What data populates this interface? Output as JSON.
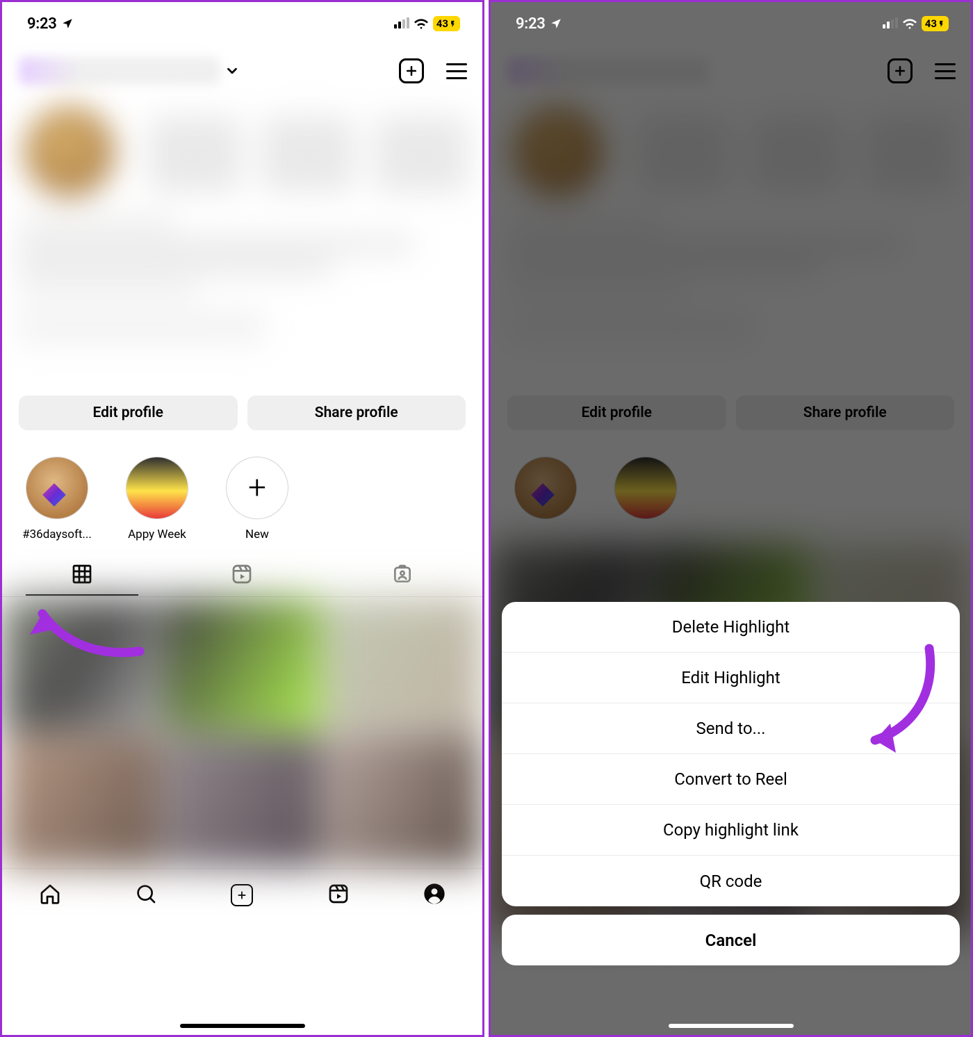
{
  "status": {
    "time": "9:23",
    "battery": "43",
    "battery_charging": true
  },
  "header": {
    "create_label": "Create",
    "menu_label": "Menu"
  },
  "actions": {
    "edit_profile": "Edit profile",
    "share_profile": "Share profile"
  },
  "highlights": [
    {
      "label": "#36daysoft...",
      "kind": "days"
    },
    {
      "label": "Appy Week",
      "kind": "appy"
    },
    {
      "label": "New",
      "kind": "new"
    }
  ],
  "profile_tabs": {
    "grid": "Posts grid",
    "reels": "Reels",
    "tagged": "Tagged"
  },
  "bottom_nav": {
    "home": "Home",
    "search": "Search",
    "create": "Create",
    "reels": "Reels",
    "profile": "Profile"
  },
  "action_sheet": {
    "items": [
      "Delete Highlight",
      "Edit Highlight",
      "Send to...",
      "Convert to Reel",
      "Copy highlight link",
      "QR code"
    ],
    "cancel": "Cancel"
  },
  "annotations": {
    "left_arrow_target": "highlight-36daysoft",
    "right_arrow_target": "Convert to Reel"
  }
}
